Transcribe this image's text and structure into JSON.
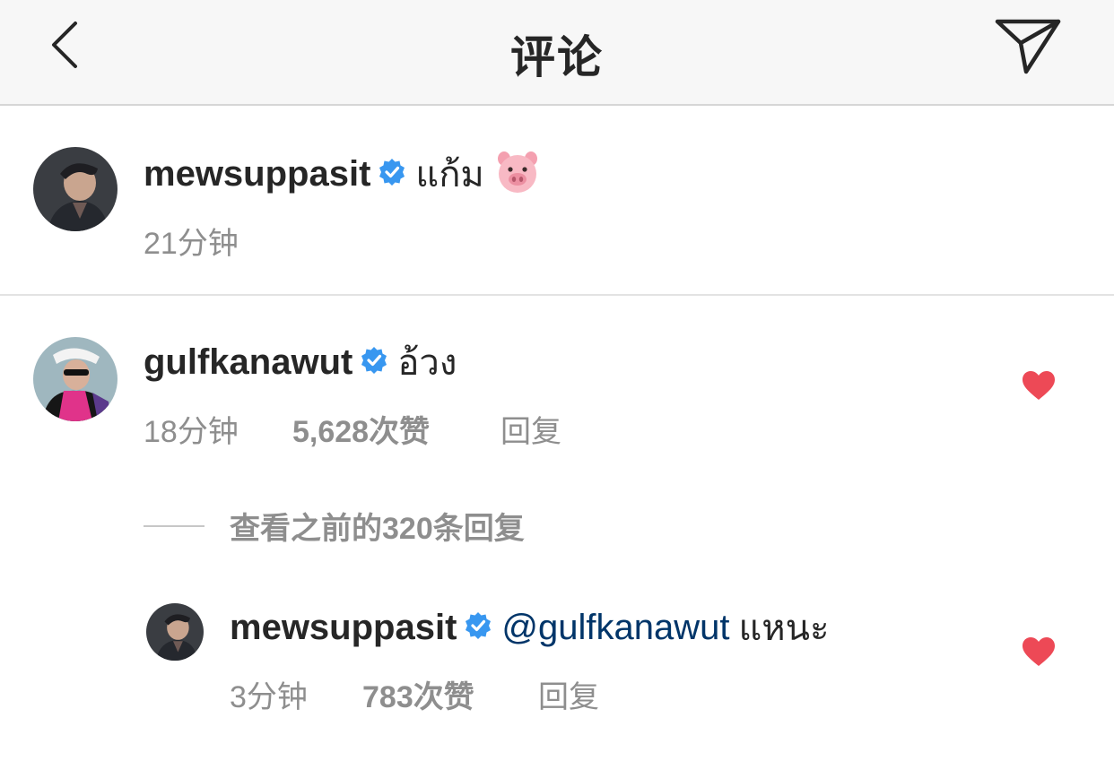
{
  "header": {
    "title": "评论",
    "back_icon": "chevron-left-icon",
    "send_icon": "paper-plane-icon"
  },
  "caption": {
    "username": "mewsuppasit",
    "verified": true,
    "text": "แก้ม",
    "emoji": "pig-face-icon",
    "time": "21分钟"
  },
  "comment": {
    "username": "gulfkanawut",
    "verified": true,
    "text": "อ้วง",
    "time": "18分钟",
    "likes": "5,628次赞",
    "reply_label": "回复",
    "liked": true
  },
  "view_previous": {
    "label": "查看之前的320条回复"
  },
  "reply": {
    "username": "mewsuppasit",
    "verified": true,
    "mention": "@gulfkanawut",
    "text": "แหนะ",
    "time": "3分钟",
    "likes": "783次赞",
    "reply_label": "回复",
    "liked": true
  },
  "colors": {
    "verified_blue": "#3897f0",
    "heart_red": "#ed4956",
    "mention_blue": "#003569",
    "meta_gray": "#8e8e8e",
    "header_bg": "#f7f7f7"
  }
}
